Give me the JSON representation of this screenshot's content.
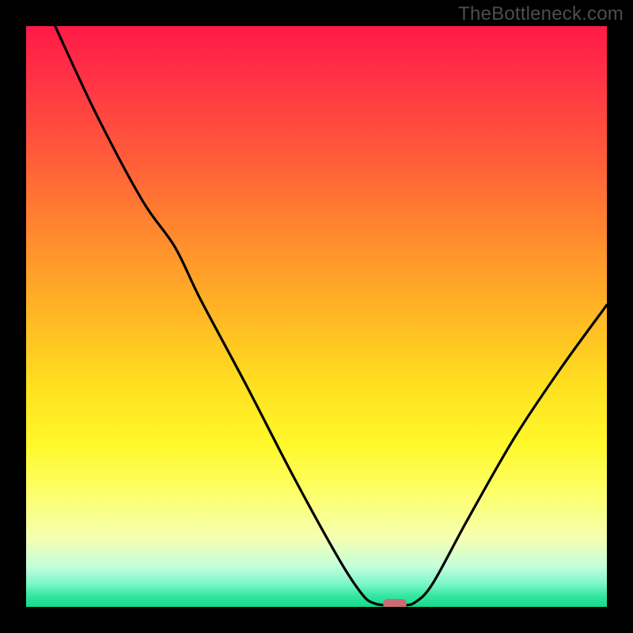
{
  "watermark": "TheBottleneck.com",
  "chart_data": {
    "type": "line",
    "title": "",
    "xlabel": "",
    "ylabel": "",
    "xlim": [
      0,
      100
    ],
    "ylim": [
      0,
      100
    ],
    "grid": false,
    "legend": false,
    "gradient_stops": [
      {
        "pos": 0,
        "color": "#ff1a48"
      },
      {
        "pos": 8,
        "color": "#ff3046"
      },
      {
        "pos": 22,
        "color": "#ff5a3a"
      },
      {
        "pos": 36,
        "color": "#ff8a2e"
      },
      {
        "pos": 50,
        "color": "#ffb824"
      },
      {
        "pos": 62,
        "color": "#ffe020"
      },
      {
        "pos": 72,
        "color": "#fff82a"
      },
      {
        "pos": 80,
        "color": "#fdff66"
      },
      {
        "pos": 88,
        "color": "#f6ffb0"
      },
      {
        "pos": 93,
        "color": "#c4ffda"
      },
      {
        "pos": 96,
        "color": "#7cf7c9"
      },
      {
        "pos": 98,
        "color": "#37e7a1"
      },
      {
        "pos": 100,
        "color": "#15d98d"
      }
    ],
    "series": [
      {
        "name": "bottleneck-curve",
        "color": "#000000",
        "points": [
          {
            "x": 5.0,
            "y": 100.0
          },
          {
            "x": 12.0,
            "y": 85.0
          },
          {
            "x": 20.0,
            "y": 70.0
          },
          {
            "x": 25.6,
            "y": 62.0
          },
          {
            "x": 30.0,
            "y": 53.0
          },
          {
            "x": 38.0,
            "y": 38.0
          },
          {
            "x": 46.0,
            "y": 22.5
          },
          {
            "x": 54.0,
            "y": 8.0
          },
          {
            "x": 58.0,
            "y": 2.0
          },
          {
            "x": 60.0,
            "y": 0.6
          },
          {
            "x": 62.0,
            "y": 0.3
          },
          {
            "x": 65.0,
            "y": 0.3
          },
          {
            "x": 67.0,
            "y": 0.8
          },
          {
            "x": 70.0,
            "y": 4.0
          },
          {
            "x": 76.0,
            "y": 15.0
          },
          {
            "x": 84.0,
            "y": 29.0
          },
          {
            "x": 92.0,
            "y": 41.0
          },
          {
            "x": 100.0,
            "y": 52.0
          }
        ]
      }
    ],
    "marker": {
      "x": 63.5,
      "y": 0.5,
      "color": "#cc6b71"
    }
  }
}
